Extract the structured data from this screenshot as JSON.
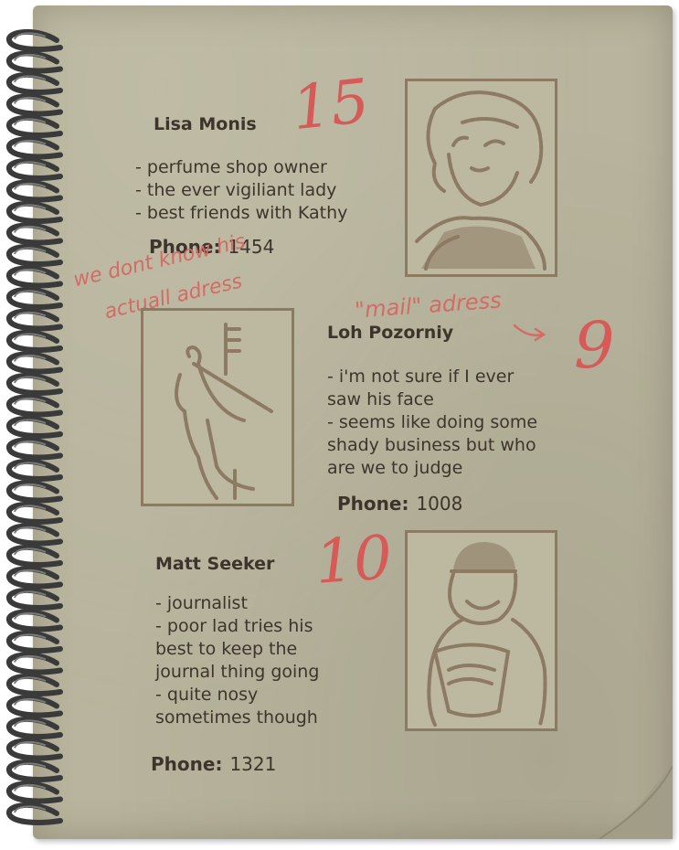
{
  "contacts": [
    {
      "name": "Lisa Monis",
      "desc": "- perfume shop owner\n- the ever vigiliant lady\n- best friends with Kathy",
      "phone_label": "Phone:",
      "phone": "1454",
      "number_note": "15"
    },
    {
      "name": "Loh Pozorniy",
      "desc": "- i'm not sure if I ever\nsaw his face\n- seems like doing some\nshady business but who\nare we to judge",
      "phone_label": "Phone:",
      "phone": "1008",
      "number_note": "9"
    },
    {
      "name": "Matt Seeker",
      "desc": "- journalist\n- poor lad tries his\nbest to keep the\njournal thing going\n- quite nosy\nsometimes though",
      "phone_label": "Phone:",
      "phone": "1321",
      "number_note": "10"
    }
  ],
  "notes": {
    "address_line1": "we dont know his",
    "address_line2": "actuall adress",
    "mail": "\"mail\" adress"
  },
  "colors": {
    "paper": "#b8b49d",
    "ink": "#3d352c",
    "sketch": "#8c7a63",
    "marker": "#d55a58"
  }
}
